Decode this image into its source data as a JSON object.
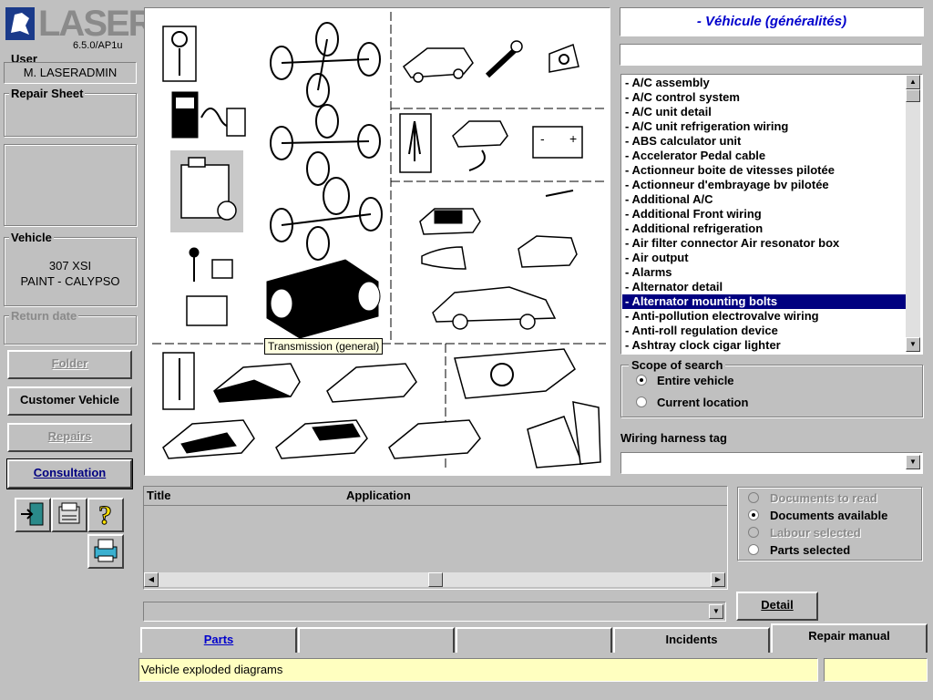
{
  "app": {
    "logo": "LASER",
    "version": "6.5.0/AP1u"
  },
  "user": {
    "label": "User",
    "value": "M. LASERADMIN"
  },
  "repair_sheet": {
    "label": "Repair Sheet"
  },
  "vehicle": {
    "label": "Vehicle",
    "line1": "307 XSI",
    "line2": "PAINT - CALYPSO"
  },
  "return_date": {
    "label": "Return date"
  },
  "nav": {
    "folder": "Folder",
    "customer_vehicle": "Customer Vehicle",
    "repairs": "Repairs",
    "consultation": "Consultation"
  },
  "diagram": {
    "tooltip": "Transmission (general)"
  },
  "location_title": "- Véhicule (généralités)",
  "search_value": "",
  "items": [
    "- A/C assembly",
    "- A/C control system",
    "- A/C unit detail",
    "- A/C unit refrigeration wiring",
    "- ABS calculator unit",
    "- Accelerator Pedal cable",
    "- Actionneur boite de vitesses pilotée",
    "- Actionneur d'embrayage bv pilotée",
    "- Additional A/C",
    "- Additional Front wiring",
    "- Additional refrigeration",
    "- Air filter connector Air resonator box",
    "- Air output",
    "- Alarms",
    "- Alternator detail",
    "- Alternator mounting bolts",
    "- Anti-pollution electrovalve wiring",
    "- Anti-roll regulation device",
    "- Ashtray clock cigar lighter"
  ],
  "selected_item": "- Alternator mounting bolts",
  "scope": {
    "label": "Scope of search",
    "options": [
      "Entire vehicle",
      "Current location"
    ],
    "selected": "Entire vehicle"
  },
  "wiring": {
    "label": "Wiring harness tag",
    "value": ""
  },
  "table": {
    "columns": [
      "Title",
      "Application"
    ]
  },
  "doc_filter": {
    "options": [
      "Documents to read",
      "Documents available",
      "Labour selected",
      "Parts selected"
    ],
    "selected": "Documents available"
  },
  "detail_button": "Detail",
  "tabs": [
    "Parts",
    "",
    "",
    "Incidents",
    "Repair manual"
  ],
  "status": {
    "text": "Vehicle exploded diagrams",
    "right": ""
  },
  "colors": {
    "selection": "#000080",
    "tooltip": "#ffffe1",
    "status": "#ffffc0",
    "title_blue": "#0000cc"
  }
}
